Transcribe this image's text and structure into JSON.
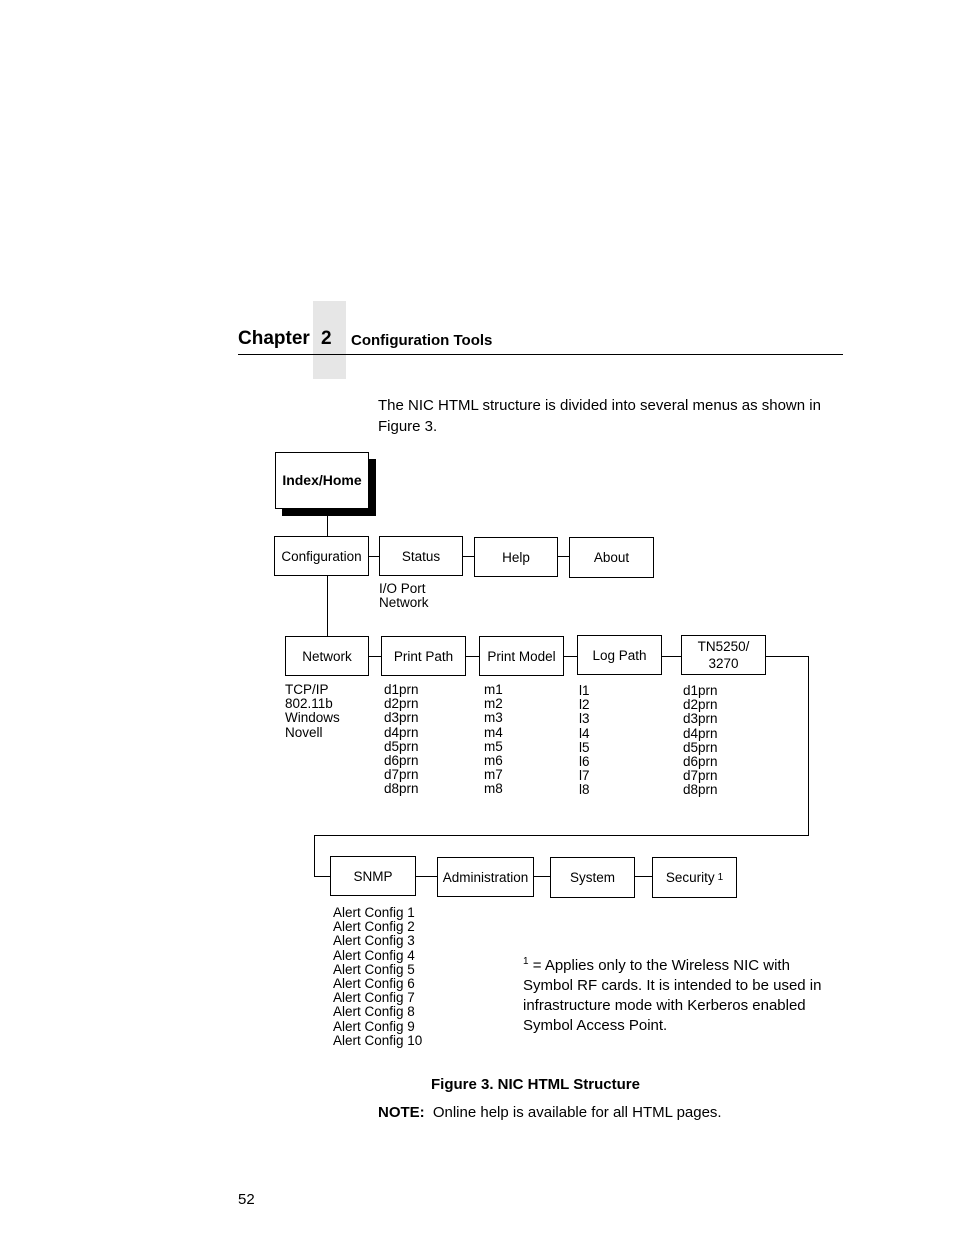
{
  "header": {
    "chapter_word": "Chapter",
    "chapter_number": "2",
    "chapter_title": "Configuration Tools"
  },
  "intro_text": "The NIC HTML structure is divided into several menus as shown in Figure 3.",
  "diagram": {
    "root": "Index/Home",
    "level1": [
      "Configuration",
      "Status",
      "Help",
      "About"
    ],
    "status_items": [
      "I/O Port",
      "Network"
    ],
    "config_row1": [
      "Network",
      "Print Path",
      "Print Model",
      "Log Path",
      "TN5250/ 3270"
    ],
    "config_row1_items": {
      "network": [
        "TCP/IP",
        "802.11b",
        "Windows",
        "Novell"
      ],
      "print_path": [
        "d1prn",
        "d2prn",
        "d3prn",
        "d4prn",
        "d5prn",
        "d6prn",
        "d7prn",
        "d8prn"
      ],
      "print_model": [
        "m1",
        "m2",
        "m3",
        "m4",
        "m5",
        "m6",
        "m7",
        "m8"
      ],
      "log_path": [
        "l1",
        "l2",
        "l3",
        "l4",
        "l5",
        "l6",
        "l7",
        "l8"
      ],
      "tn5250": [
        "d1prn",
        "d2prn",
        "d3prn",
        "d4prn",
        "d5prn",
        "d6prn",
        "d7prn",
        "d8prn"
      ]
    },
    "config_row2": [
      "SNMP",
      "Administration",
      "System",
      "Security"
    ],
    "security_superscript": "1",
    "snmp_items": [
      "Alert Config 1",
      "Alert Config 2",
      "Alert Config 3",
      "Alert Config 4",
      "Alert Config 5",
      "Alert Config 6",
      "Alert Config 7",
      "Alert Config 8",
      "Alert Config 9",
      "Alert Config 10"
    ]
  },
  "footnote": {
    "marker": "1",
    "text": " = Applies only to the Wireless NIC with Symbol RF cards. It is intended to be used in infrastructure mode with Kerberos enabled Symbol Access Point."
  },
  "figure_caption": "Figure 3. NIC HTML Structure",
  "note": {
    "label": "NOTE:",
    "text": "Online help is available for all HTML pages."
  },
  "page_number": "52"
}
